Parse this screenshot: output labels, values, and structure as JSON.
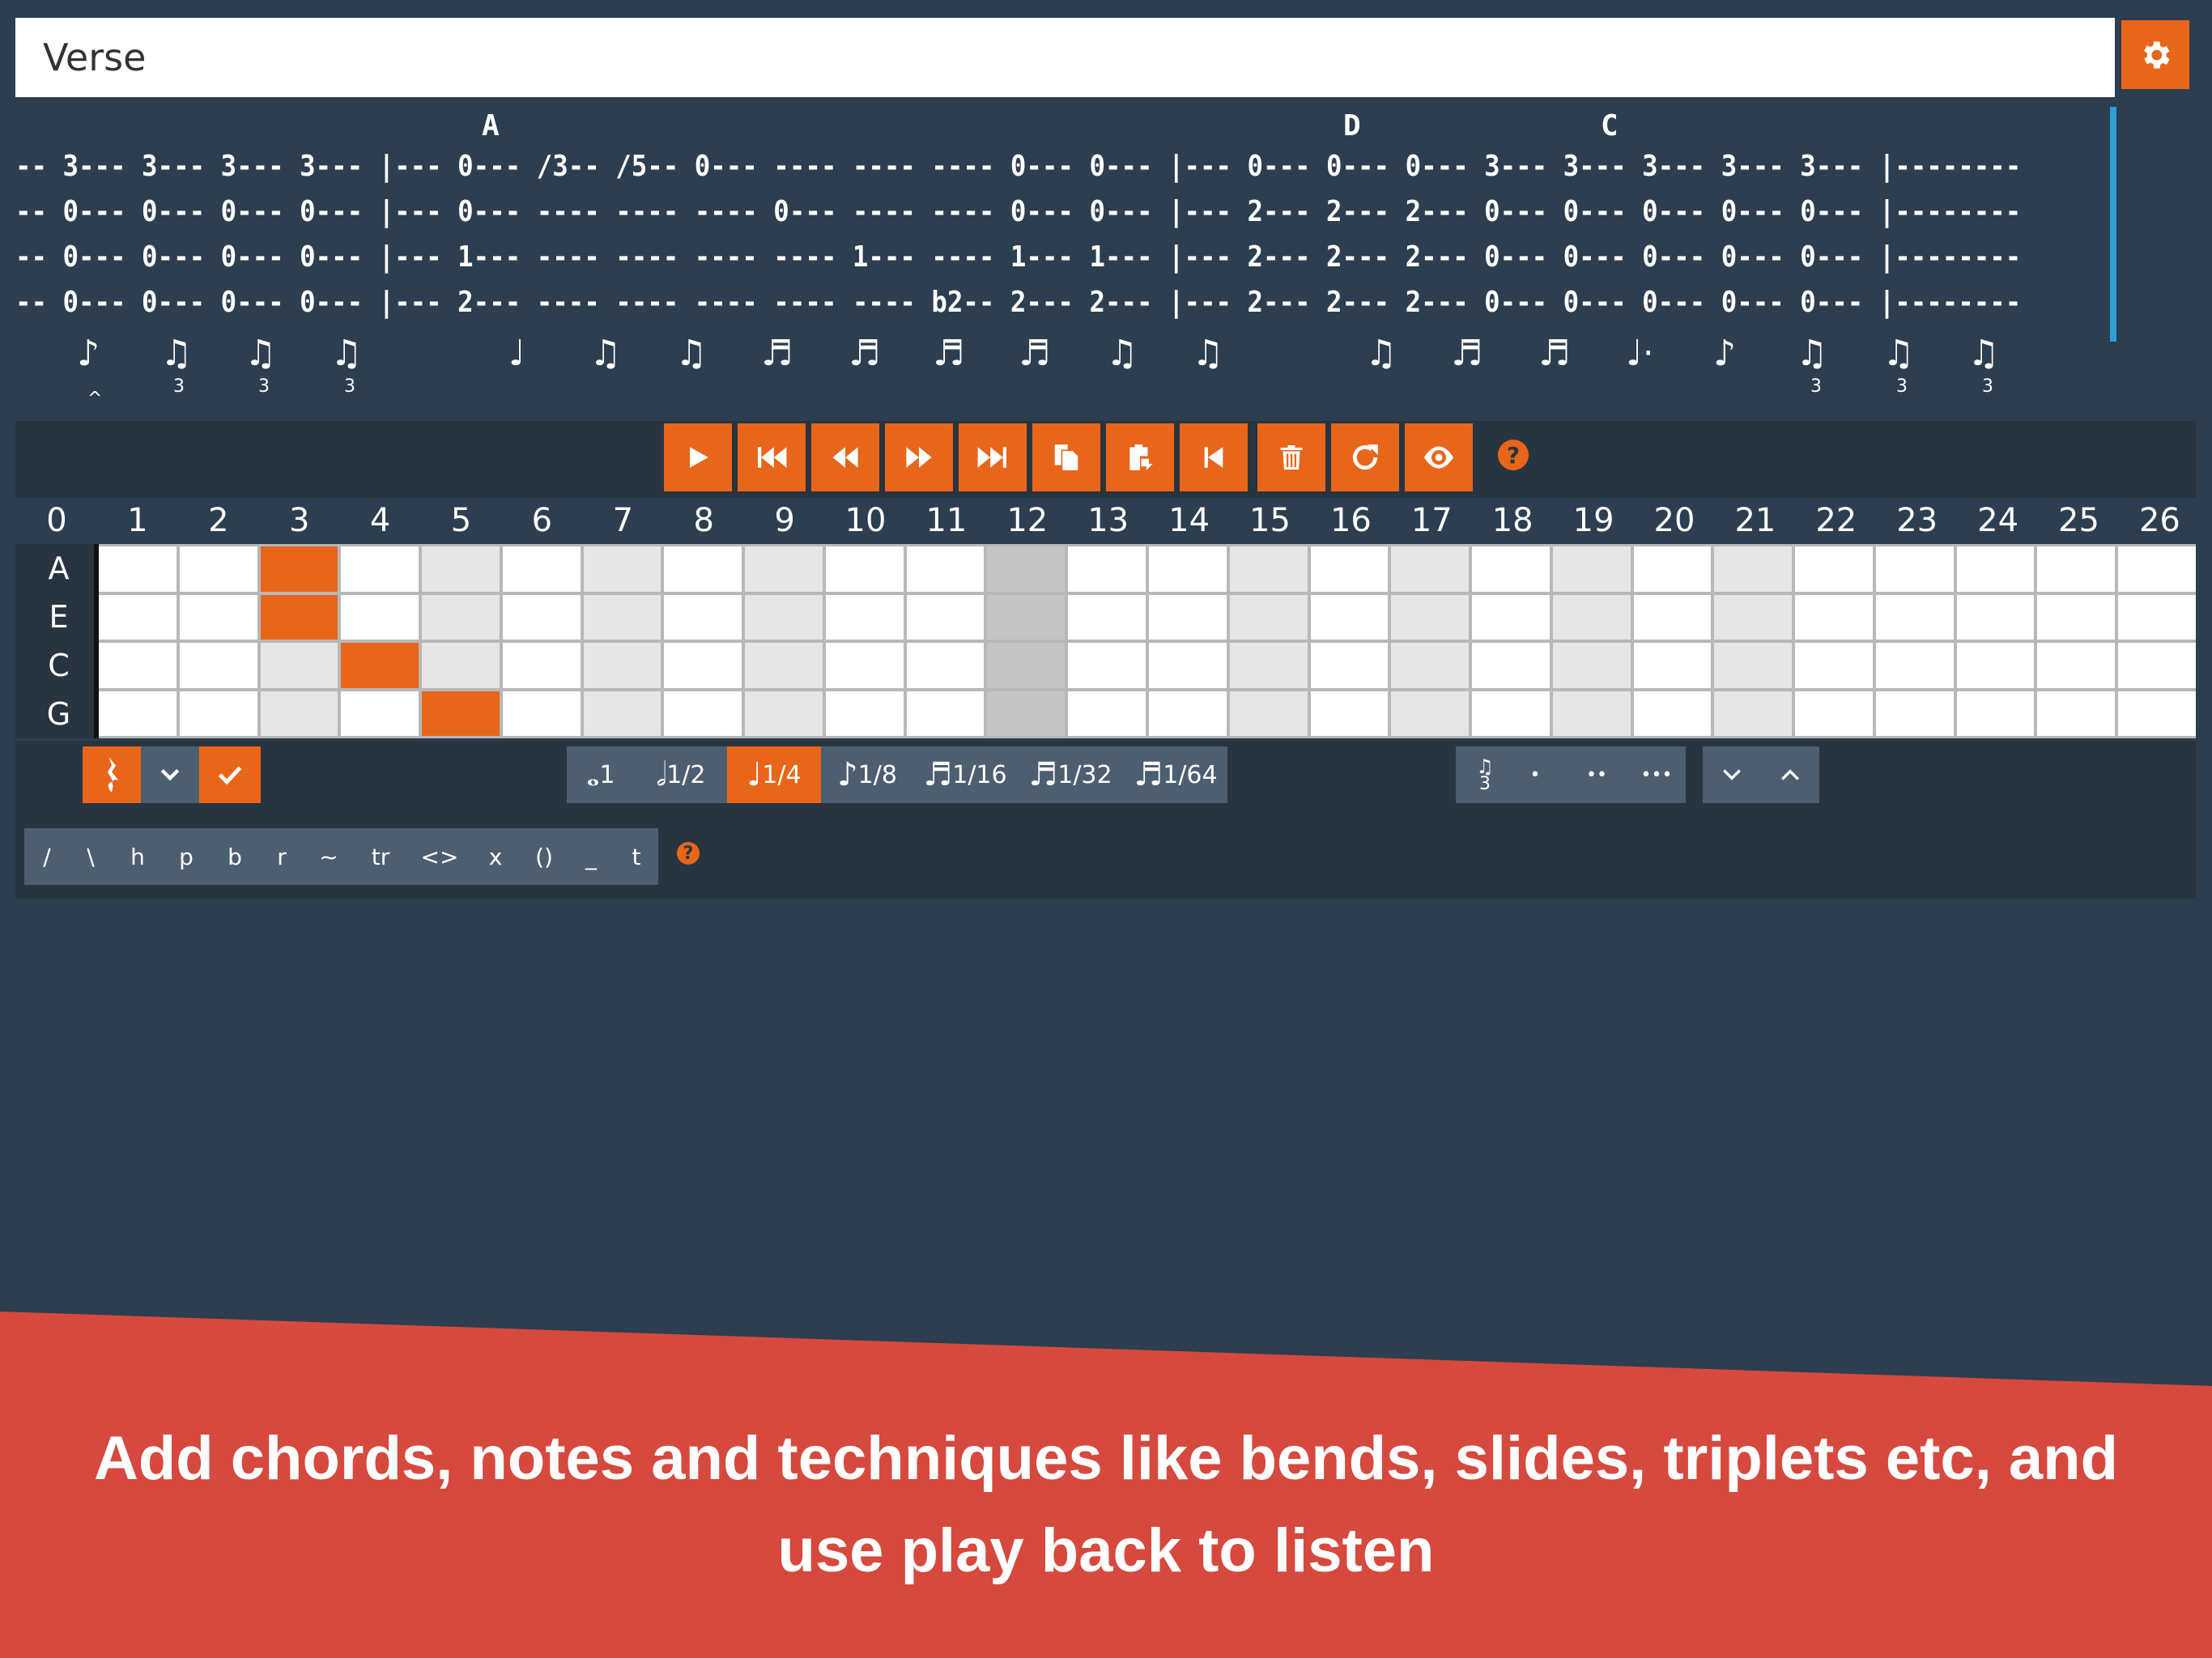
{
  "section": {
    "title": "Verse",
    "settings_icon": "gear-icon"
  },
  "tab": {
    "chords": [
      {
        "label": "A"
      },
      {
        "label": "D"
      },
      {
        "label": "C"
      }
    ],
    "lines": [
      "-- 3--- 3--- 3--- 3--- |--- 0--- /3-- /5-- 0--- ---- ---- ---- 0--- 0--- |--- 0--- 0--- 0--- 3--- 3--- 3--- 3--- 3--- |--------",
      "-- 0--- 0--- 0--- 0--- |--- 0--- ---- ---- ---- 0--- ---- ---- 0--- 0--- |--- 2--- 2--- 2--- 0--- 0--- 0--- 0--- 0--- |--------",
      "-- 0--- 0--- 0--- 0--- |--- 1--- ---- ---- ---- ---- 1--- ---- 1--- 1--- |--- 2--- 2--- 2--- 0--- 0--- 0--- 0--- 0--- |--------",
      "-- 0--- 0--- 0--- 0--- |--- 2--- ---- ---- ---- ---- ---- b2-- 2--- 2--- |--- 2--- 2--- 2--- 0--- 0--- 0--- 0--- 0--- |--------"
    ],
    "triplet_mark": "3"
  },
  "toolbar": {
    "buttons": [
      {
        "name": "play-button",
        "icon": "play-icon"
      },
      {
        "name": "skip-to-start-button",
        "icon": "skip-start-icon"
      },
      {
        "name": "rewind-button",
        "icon": "rewind-icon"
      },
      {
        "name": "fast-forward-button",
        "icon": "fast-forward-icon"
      },
      {
        "name": "skip-to-end-button",
        "icon": "skip-end-icon"
      },
      {
        "name": "copy-button",
        "icon": "copy-icon"
      },
      {
        "name": "paste-button",
        "icon": "paste-icon"
      },
      {
        "name": "go-to-start-button",
        "icon": "step-back-icon"
      },
      {
        "name": "delete-button",
        "icon": "trash-icon"
      },
      {
        "name": "refresh-button",
        "icon": "refresh-icon"
      },
      {
        "name": "view-button",
        "icon": "eye-icon"
      }
    ],
    "help_label": "?"
  },
  "fretboard": {
    "frets": [
      "0",
      "1",
      "2",
      "3",
      "4",
      "5",
      "6",
      "7",
      "8",
      "9",
      "10",
      "11",
      "12",
      "13",
      "14",
      "15",
      "16",
      "17",
      "18",
      "19",
      "20",
      "21",
      "22",
      "23",
      "24",
      "25",
      "26"
    ],
    "strings": [
      "A",
      "E",
      "C",
      "G"
    ],
    "selected": {
      "A": 3,
      "E": 3,
      "C": 4,
      "G": 5
    },
    "accent_color": "#e8661a"
  },
  "durations": [
    {
      "label": "1"
    },
    {
      "label": "1/2"
    },
    {
      "label": "1/4",
      "active": true
    },
    {
      "label": "1/8"
    },
    {
      "label": "1/16"
    },
    {
      "label": "1/32"
    },
    {
      "label": "1/64"
    }
  ],
  "techniques": [
    "/",
    "\\",
    "h",
    "p",
    "b",
    "r",
    "~",
    "tr",
    "<>",
    "x",
    "()",
    "_",
    "t"
  ],
  "tuplets": {
    "triplet_label": "3",
    "dot_labels": [
      "•",
      "••",
      "•••"
    ]
  },
  "banner": {
    "text": "Add chords, notes and techniques like bends, slides, triplets etc, and use play back to listen",
    "color": "#d6493e"
  }
}
